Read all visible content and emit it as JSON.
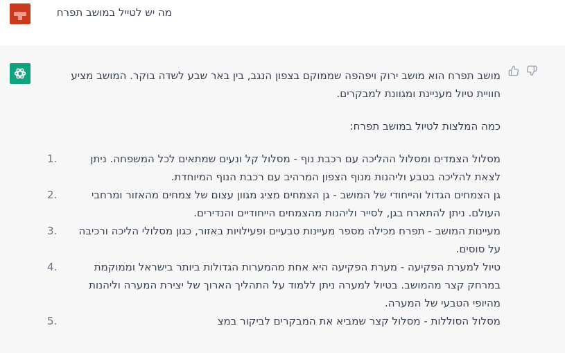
{
  "user_message": {
    "avatar_icon": "user-avatar-icon",
    "text": "מה יש לטייל במושב תפרח"
  },
  "assistant_message": {
    "avatar_icon": "openai-logo-icon",
    "intro": "מושב תפרח הוא מושב ירוק ויפהפה שממוקם בצפון הנגב, בין באר שבע לשדה בוקר. המושב מציע חוויית טיול מעניינת ומגוונת למבקרים.",
    "list_heading": "כמה המלצות לטיול במושב תפרח:",
    "items": [
      {
        "num": "1.",
        "text": "מסלול הצמדים ומסלול ההליכה עם רכבת נוף - מסלול קל ונעים שמתאים לכל המשפחה. ניתן לצאת להליכה בטבע וליהנות מנוף הצפון המרהיב עם רכבת הנוף המיוחדת."
      },
      {
        "num": "2.",
        "text": "גן הצמחים הגדול והייחודי של המושב - גן הצמחים מציג מגוון עצום של צמחים מהאזור ומרחבי העולם. ניתן להתארח בגן, לסייר וליהנות מהצמחים הייחודיים והנדירים."
      },
      {
        "num": "3.",
        "text": "מעיינות המושב - תפרח מכילה מספר מעיינות טבעיים ופעילויות באזור, כגון מסלולי הליכה ורכיבה על סוסים."
      },
      {
        "num": "4.",
        "text": "טיול למערת הפקיעה - מערת הפקיעה היא אחת מהמערות הגדולות ביותר בישראל וממוקמת במרחק קצר מהמושב. בטיול למערה ניתן ללמוד על התהליך הארוך של יצירת המערה וליהנות מהיופי הטבעי של המערה."
      },
      {
        "num": "5.",
        "text": "מסלול הסוללות - מסלול קצר שמביא את המבקרים לביקור במצ"
      }
    ],
    "feedback": {
      "thumbs_up_icon": "thumbs-up-icon",
      "thumbs_down_icon": "thumbs-down-icon"
    }
  }
}
